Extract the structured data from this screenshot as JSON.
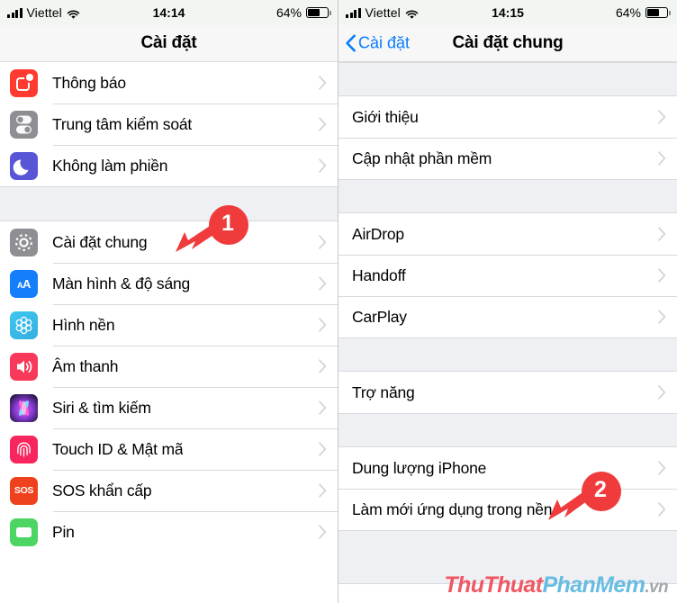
{
  "left_phone": {
    "status_bar": {
      "carrier": "Viettel",
      "time": "14:14",
      "battery": "64%",
      "wifi_icon": "wifi-icon",
      "signal_icon": "signal-bars-icon",
      "battery_icon": "battery-icon"
    },
    "nav": {
      "title": "Cài đặt"
    },
    "groups": [
      {
        "items": [
          {
            "label": "Thông báo",
            "icon": "notifications-icon"
          },
          {
            "label": "Trung tâm kiểm soát",
            "icon": "control-center-icon"
          },
          {
            "label": "Không làm phiền",
            "icon": "do-not-disturb-icon"
          }
        ]
      },
      {
        "items": [
          {
            "label": "Cài đặt chung",
            "icon": "general-settings-icon"
          },
          {
            "label": "Màn hình & độ sáng",
            "icon": "display-brightness-icon"
          },
          {
            "label": "Hình nền",
            "icon": "wallpaper-icon"
          },
          {
            "label": "Âm thanh",
            "icon": "sounds-icon"
          },
          {
            "label": "Siri & tìm kiếm",
            "icon": "siri-icon"
          },
          {
            "label": "Touch ID & Mật mã",
            "icon": "touch-id-icon"
          },
          {
            "label": "SOS khẩn cấp",
            "icon": "emergency-sos-icon"
          },
          {
            "label": "Pin",
            "icon": "battery-settings-icon"
          }
        ]
      }
    ],
    "annotation": {
      "number": "1"
    }
  },
  "right_phone": {
    "status_bar": {
      "carrier": "Viettel",
      "time": "14:15",
      "battery": "64%",
      "wifi_icon": "wifi-icon",
      "signal_icon": "signal-bars-icon",
      "battery_icon": "battery-icon"
    },
    "nav": {
      "back_label": "Cài đặt",
      "title": "Cài đặt chung",
      "back_icon": "chevron-left-icon"
    },
    "groups": [
      {
        "items": [
          {
            "label": "Giới thiệu"
          },
          {
            "label": "Cập nhật phần mềm"
          }
        ]
      },
      {
        "items": [
          {
            "label": "AirDrop"
          },
          {
            "label": "Handoff"
          },
          {
            "label": "CarPlay"
          }
        ]
      },
      {
        "items": [
          {
            "label": "Trợ năng"
          }
        ]
      },
      {
        "items": [
          {
            "label": "Dung lượng iPhone"
          },
          {
            "label": "Làm mới ứng dụng trong nền"
          }
        ]
      }
    ],
    "annotation": {
      "number": "2"
    },
    "watermark": {
      "part1": "ThuThuat",
      "part2": "PhanMem",
      "part3": ".vn"
    }
  },
  "colors": {
    "accent_blue": "#0a7cff",
    "annotation_red": "#ef3b3b",
    "group_bg": "#eff0f4",
    "separator": "#d8d9dd"
  }
}
